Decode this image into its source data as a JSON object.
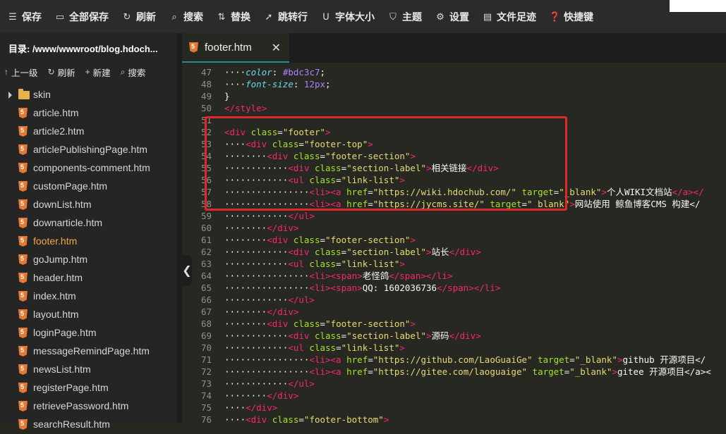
{
  "toolbar": {
    "buttons": [
      {
        "icon": "menu-save-icon",
        "label": "保存"
      },
      {
        "icon": "save-all-icon",
        "label": "全部保存"
      },
      {
        "icon": "refresh-icon",
        "label": "刷新"
      },
      {
        "icon": "search-icon",
        "label": "搜索"
      },
      {
        "icon": "replace-icon",
        "label": "替换"
      },
      {
        "icon": "wrap-icon",
        "label": "跳转行"
      },
      {
        "icon": "font-size-icon",
        "label": "字体大小"
      },
      {
        "icon": "theme-icon",
        "label": "主题"
      },
      {
        "icon": "gear-icon",
        "label": "设置"
      },
      {
        "icon": "file-trace-icon",
        "label": "文件足迹"
      },
      {
        "icon": "help-icon",
        "label": "快捷键"
      }
    ]
  },
  "sidebar": {
    "title": "目录: /www/wwwroot/blog.hdoch...",
    "actions": [
      {
        "icon": "up-arrow-icon",
        "label": "上一级"
      },
      {
        "icon": "refresh-icon",
        "label": "刷新"
      },
      {
        "icon": "plus-icon",
        "label": "新建"
      },
      {
        "icon": "search-icon",
        "label": "搜索"
      }
    ],
    "files": [
      {
        "type": "folder",
        "name": "skin"
      },
      {
        "type": "html",
        "name": "article.htm"
      },
      {
        "type": "html",
        "name": "article2.htm"
      },
      {
        "type": "html",
        "name": "articlePublishingPage.htm"
      },
      {
        "type": "html",
        "name": "components-comment.htm"
      },
      {
        "type": "html",
        "name": "customPage.htm"
      },
      {
        "type": "html",
        "name": "downList.htm"
      },
      {
        "type": "html",
        "name": "downarticle.htm"
      },
      {
        "type": "html",
        "name": "footer.htm",
        "active": true
      },
      {
        "type": "html",
        "name": "goJump.htm"
      },
      {
        "type": "html",
        "name": "header.htm"
      },
      {
        "type": "html",
        "name": "index.htm"
      },
      {
        "type": "html",
        "name": "layout.htm"
      },
      {
        "type": "html",
        "name": "loginPage.htm"
      },
      {
        "type": "html",
        "name": "messageRemindPage.htm"
      },
      {
        "type": "html",
        "name": "newsList.htm"
      },
      {
        "type": "html",
        "name": "registerPage.htm"
      },
      {
        "type": "html",
        "name": "retrievePassword.htm"
      },
      {
        "type": "html",
        "name": "searchResult.htm"
      }
    ]
  },
  "editor": {
    "tab_label": "footer.htm",
    "close_glyph": "✕",
    "collapse_glyph": "❮",
    "lines": [
      {
        "n": "47",
        "tokens": [
          [
            "ws",
            "····"
          ],
          [
            "propi",
            "color"
          ],
          [
            "prop",
            ": "
          ],
          [
            "val",
            "#bdc3c7"
          ],
          [
            "prop",
            ";"
          ]
        ]
      },
      {
        "n": "48",
        "tokens": [
          [
            "ws",
            "····"
          ],
          [
            "propi",
            "font-size"
          ],
          [
            "prop",
            ": "
          ],
          [
            "val",
            "12px"
          ],
          [
            "prop",
            ";"
          ]
        ]
      },
      {
        "n": "49",
        "tokens": [
          [
            "prop",
            "}"
          ]
        ]
      },
      {
        "n": "50",
        "tokens": [
          [
            "tag",
            "</"
          ],
          [
            "tag",
            "style"
          ],
          [
            "tag",
            ">"
          ]
        ]
      },
      {
        "n": "51",
        "tokens": []
      },
      {
        "n": "52",
        "tokens": [
          [
            "tag",
            "<div"
          ],
          [
            "text",
            " "
          ],
          [
            "attr",
            "class"
          ],
          [
            "text",
            "="
          ],
          [
            "str",
            "\"footer\""
          ],
          [
            "tag",
            ">"
          ]
        ]
      },
      {
        "n": "53",
        "tokens": [
          [
            "ws",
            "····"
          ],
          [
            "tag",
            "<div"
          ],
          [
            "text",
            " "
          ],
          [
            "attr",
            "class"
          ],
          [
            "text",
            "="
          ],
          [
            "str",
            "\"footer-top\""
          ],
          [
            "tag",
            ">"
          ]
        ]
      },
      {
        "n": "54",
        "tokens": [
          [
            "ws",
            "········"
          ],
          [
            "tag",
            "<div"
          ],
          [
            "text",
            " "
          ],
          [
            "attr",
            "class"
          ],
          [
            "text",
            "="
          ],
          [
            "str",
            "\"footer-section\""
          ],
          [
            "tag",
            ">"
          ]
        ]
      },
      {
        "n": "55",
        "tokens": [
          [
            "ws",
            "············"
          ],
          [
            "tag",
            "<div"
          ],
          [
            "text",
            " "
          ],
          [
            "attr",
            "class"
          ],
          [
            "text",
            "="
          ],
          [
            "str",
            "\"section-label\""
          ],
          [
            "tag",
            ">"
          ],
          [
            "text",
            "相关链接"
          ],
          [
            "tag",
            "</div>"
          ]
        ]
      },
      {
        "n": "56",
        "tokens": [
          [
            "ws",
            "············"
          ],
          [
            "tag",
            "<ul"
          ],
          [
            "text",
            " "
          ],
          [
            "attr",
            "class"
          ],
          [
            "text",
            "="
          ],
          [
            "str",
            "\"link-list\""
          ],
          [
            "tag",
            ">"
          ]
        ]
      },
      {
        "n": "57",
        "tokens": [
          [
            "ws",
            "················"
          ],
          [
            "tag",
            "<li>"
          ],
          [
            "tag",
            "<a"
          ],
          [
            "text",
            " "
          ],
          [
            "attr",
            "href"
          ],
          [
            "text",
            "="
          ],
          [
            "str",
            "\"https://wiki.hdochub.com/\""
          ],
          [
            "text",
            " "
          ],
          [
            "attr",
            "target"
          ],
          [
            "text",
            "="
          ],
          [
            "str",
            "\"_blank\""
          ],
          [
            "tag",
            ">"
          ],
          [
            "text",
            "个人WIKI文档站"
          ],
          [
            "tag",
            "</a></"
          ]
        ]
      },
      {
        "n": "58",
        "tokens": [
          [
            "ws",
            "················"
          ],
          [
            "tag",
            "<li>"
          ],
          [
            "tag",
            "<a"
          ],
          [
            "text",
            " "
          ],
          [
            "attr",
            "href"
          ],
          [
            "text",
            "="
          ],
          [
            "str",
            "\"https://jycms.site/\""
          ],
          [
            "text",
            " "
          ],
          [
            "attr",
            "target"
          ],
          [
            "text",
            "="
          ],
          [
            "str",
            "\"_blank\""
          ],
          [
            "tag",
            ">"
          ],
          [
            "text",
            "网站使用 鲸鱼博客CMS 构建</"
          ]
        ]
      },
      {
        "n": "59",
        "tokens": [
          [
            "ws",
            "············"
          ],
          [
            "tag",
            "</ul>"
          ]
        ]
      },
      {
        "n": "60",
        "tokens": [
          [
            "ws",
            "········"
          ],
          [
            "tag",
            "</div>"
          ]
        ]
      },
      {
        "n": "61",
        "tokens": [
          [
            "ws",
            "········"
          ],
          [
            "tag",
            "<div"
          ],
          [
            "text",
            " "
          ],
          [
            "attr",
            "class"
          ],
          [
            "text",
            "="
          ],
          [
            "str",
            "\"footer-section\""
          ],
          [
            "tag",
            ">"
          ]
        ]
      },
      {
        "n": "62",
        "tokens": [
          [
            "ws",
            "············"
          ],
          [
            "tag",
            "<div"
          ],
          [
            "text",
            " "
          ],
          [
            "attr",
            "class"
          ],
          [
            "text",
            "="
          ],
          [
            "str",
            "\"section-label\""
          ],
          [
            "tag",
            ">"
          ],
          [
            "text",
            "站长"
          ],
          [
            "tag",
            "</div>"
          ]
        ]
      },
      {
        "n": "63",
        "tokens": [
          [
            "ws",
            "············"
          ],
          [
            "tag",
            "<ul"
          ],
          [
            "text",
            " "
          ],
          [
            "attr",
            "class"
          ],
          [
            "text",
            "="
          ],
          [
            "str",
            "\"link-list\""
          ],
          [
            "tag",
            ">"
          ]
        ]
      },
      {
        "n": "64",
        "tokens": [
          [
            "ws",
            "················"
          ],
          [
            "tag",
            "<li>"
          ],
          [
            "tag",
            "<span>"
          ],
          [
            "text",
            "老怪鸽"
          ],
          [
            "tag",
            "</span></li>"
          ]
        ]
      },
      {
        "n": "65",
        "tokens": [
          [
            "ws",
            "················"
          ],
          [
            "tag",
            "<li>"
          ],
          [
            "tag",
            "<span>"
          ],
          [
            "text",
            "QQ: 1602036736"
          ],
          [
            "tag",
            "</span></li>"
          ]
        ]
      },
      {
        "n": "66",
        "tokens": [
          [
            "ws",
            "············"
          ],
          [
            "tag",
            "</ul>"
          ]
        ]
      },
      {
        "n": "67",
        "tokens": [
          [
            "ws",
            "········"
          ],
          [
            "tag",
            "</div>"
          ]
        ]
      },
      {
        "n": "68",
        "tokens": [
          [
            "ws",
            "········"
          ],
          [
            "tag",
            "<div"
          ],
          [
            "text",
            " "
          ],
          [
            "attr",
            "class"
          ],
          [
            "text",
            "="
          ],
          [
            "str",
            "\"footer-section\""
          ],
          [
            "tag",
            ">"
          ]
        ]
      },
      {
        "n": "69",
        "tokens": [
          [
            "ws",
            "············"
          ],
          [
            "tag",
            "<div"
          ],
          [
            "text",
            " "
          ],
          [
            "attr",
            "class"
          ],
          [
            "text",
            "="
          ],
          [
            "str",
            "\"section-label\""
          ],
          [
            "tag",
            ">"
          ],
          [
            "text",
            "源码"
          ],
          [
            "tag",
            "</div>"
          ]
        ]
      },
      {
        "n": "70",
        "tokens": [
          [
            "ws",
            "············"
          ],
          [
            "tag",
            "<ul"
          ],
          [
            "text",
            " "
          ],
          [
            "attr",
            "class"
          ],
          [
            "text",
            "="
          ],
          [
            "str",
            "\"link-list\""
          ],
          [
            "tag",
            ">"
          ]
        ]
      },
      {
        "n": "71",
        "tokens": [
          [
            "ws",
            "················"
          ],
          [
            "tag",
            "<li>"
          ],
          [
            "tag",
            "<a"
          ],
          [
            "text",
            " "
          ],
          [
            "attr",
            "href"
          ],
          [
            "text",
            "="
          ],
          [
            "str",
            "\"https://github.com/LaoGuaiGe\""
          ],
          [
            "text",
            " "
          ],
          [
            "attr",
            "target"
          ],
          [
            "text",
            "="
          ],
          [
            "str",
            "\"_blank\""
          ],
          [
            "tag",
            ">"
          ],
          [
            "text",
            "github 开源项目</"
          ]
        ]
      },
      {
        "n": "72",
        "tokens": [
          [
            "ws",
            "················"
          ],
          [
            "tag",
            "<li>"
          ],
          [
            "tag",
            "<a"
          ],
          [
            "text",
            " "
          ],
          [
            "attr",
            "href"
          ],
          [
            "text",
            "="
          ],
          [
            "str",
            "\"https://gitee.com/laoguaige\""
          ],
          [
            "text",
            " "
          ],
          [
            "attr",
            "target"
          ],
          [
            "text",
            "="
          ],
          [
            "str",
            "\"_blank\""
          ],
          [
            "tag",
            ">"
          ],
          [
            "text",
            "gitee 开源项目</a><"
          ]
        ]
      },
      {
        "n": "73",
        "tokens": [
          [
            "ws",
            "············"
          ],
          [
            "tag",
            "</ul>"
          ]
        ]
      },
      {
        "n": "74",
        "tokens": [
          [
            "ws",
            "········"
          ],
          [
            "tag",
            "</div>"
          ]
        ]
      },
      {
        "n": "75",
        "tokens": [
          [
            "ws",
            "····"
          ],
          [
            "tag",
            "</div>"
          ]
        ]
      },
      {
        "n": "76",
        "tokens": [
          [
            "ws",
            "····"
          ],
          [
            "tag",
            "<div"
          ],
          [
            "text",
            " "
          ],
          [
            "attr",
            "class"
          ],
          [
            "text",
            "="
          ],
          [
            "str",
            "\"footer-bottom\""
          ],
          [
            "tag",
            ">"
          ]
        ]
      }
    ]
  }
}
